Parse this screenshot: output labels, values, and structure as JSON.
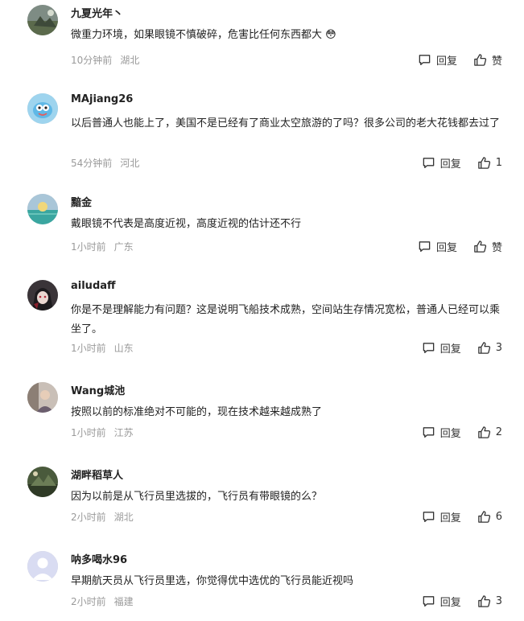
{
  "actions": {
    "reply_label": "回复"
  },
  "comments": [
    {
      "name": "九夏光年丶",
      "text": "微重力环境，如果眼镜不慎破碎，危害比任何东西都大 😳",
      "time": "10分钟前",
      "location": "湖北",
      "likes": "赞",
      "avatar_icon": "avatar-landscape-icon"
    },
    {
      "name": "MAjiang26",
      "text": "以后普通人也能上了，美国不是已经有了商业太空旅游的了吗？很多公司的老大花钱都去过了",
      "time": "54分钟前",
      "location": "河北",
      "likes": "1",
      "avatar_icon": "avatar-cartoon-fish-icon"
    },
    {
      "name": "黯金",
      "text": "戴眼镜不代表是高度近视，高度近视的估计还不行",
      "time": "1小时前",
      "location": "广东",
      "likes": "赞",
      "avatar_icon": "avatar-sunset-sea-icon"
    },
    {
      "name": "ailudaff",
      "text": "你是不是理解能力有问题？这是说明飞船技术成熟，空间站生存情况宽松，普通人已经可以乘坐了。",
      "time": "1小时前",
      "location": "山东",
      "likes": "3",
      "avatar_icon": "avatar-anime-character-icon"
    },
    {
      "name": "Wang城池",
      "text": "按照以前的标准绝对不可能的，现在技术越来越成熟了",
      "time": "1小时前",
      "location": "江苏",
      "likes": "2",
      "avatar_icon": "avatar-photo-icon"
    },
    {
      "name": "湖畔稻草人",
      "text": "因为以前是从飞行员里选拔的，飞行员有带眼镜的么？",
      "time": "2小时前",
      "location": "湖北",
      "likes": "6",
      "avatar_icon": "avatar-landscape-icon"
    },
    {
      "name": "呐多喝水96",
      "text": "早期航天员从飞行员里选，你觉得优中选优的飞行员能近视吗",
      "time": "2小时前",
      "location": "福建",
      "likes": "3",
      "avatar_icon": "avatar-default-user-icon"
    }
  ]
}
